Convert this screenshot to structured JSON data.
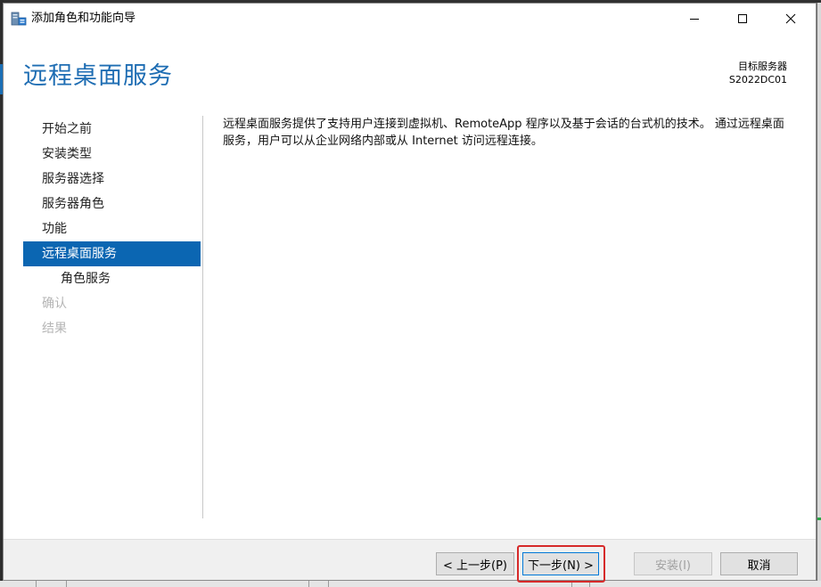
{
  "window": {
    "title": "添加角色和功能向导"
  },
  "header": {
    "page_title": "远程桌面服务",
    "target_server_label": "目标服务器",
    "target_server_value": "S2022DC01"
  },
  "nav": {
    "items": [
      {
        "label": "开始之前",
        "state": "normal"
      },
      {
        "label": "安装类型",
        "state": "normal"
      },
      {
        "label": "服务器选择",
        "state": "normal"
      },
      {
        "label": "服务器角色",
        "state": "normal"
      },
      {
        "label": "功能",
        "state": "normal"
      },
      {
        "label": "远程桌面服务",
        "state": "active"
      },
      {
        "label": "角色服务",
        "state": "sub"
      },
      {
        "label": "确认",
        "state": "disabled"
      },
      {
        "label": "结果",
        "state": "disabled"
      }
    ]
  },
  "content": {
    "description": "远程桌面服务提供了支持用户连接到虚拟机、RemoteApp 程序以及基于会话的台式机的技术。 通过远程桌面服务，用户可以从企业网络内部或从 Internet 访问远程连接。"
  },
  "footer": {
    "prev_label": "< 上一步(P)",
    "next_label": "下一步(N) >",
    "install_label": "安装(I)",
    "cancel_label": "取消"
  },
  "colors": {
    "accent": "#0b66b2",
    "title_blue": "#1e6db3",
    "highlight_red": "#d62a2a"
  },
  "icons": {
    "app": "server-manager-icon",
    "minimize": "minimize-icon",
    "maximize": "maximize-icon",
    "close": "close-icon"
  }
}
